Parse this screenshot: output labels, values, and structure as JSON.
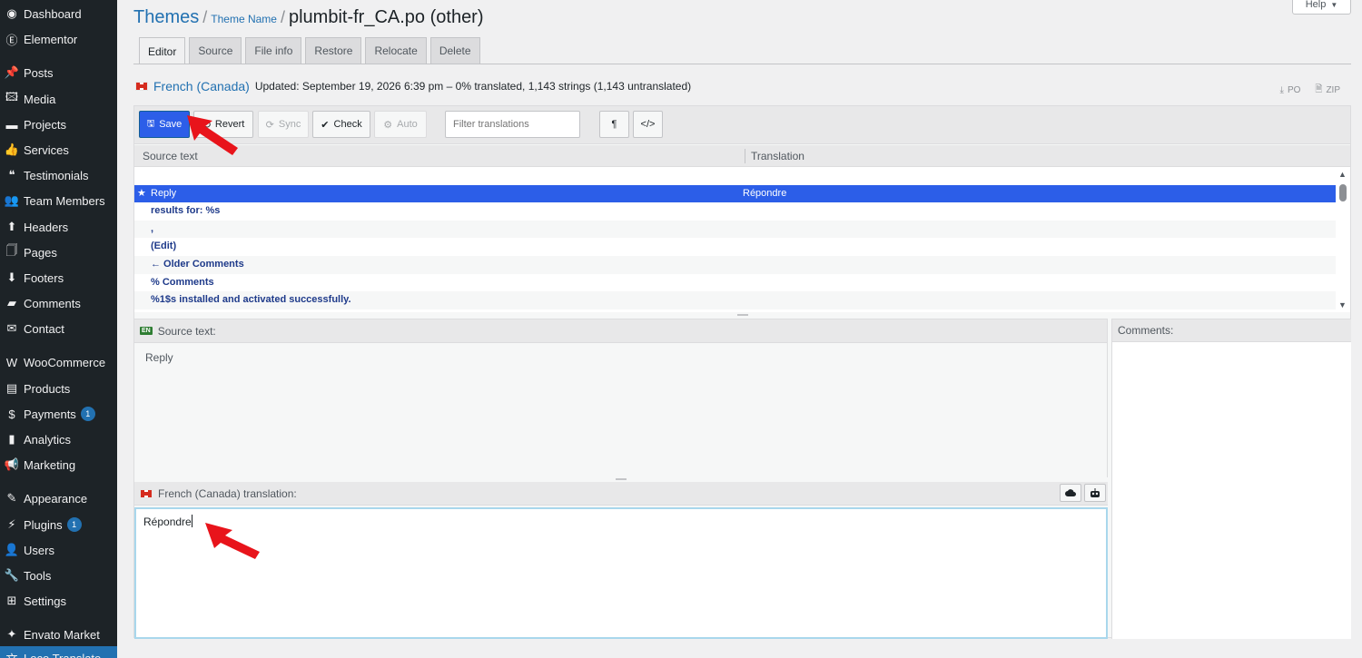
{
  "sidebar": {
    "items": [
      {
        "label": "Dashboard",
        "icon": "dashboard-icon",
        "badge": ""
      },
      {
        "label": "Elementor",
        "icon": "elementor-icon",
        "badge": ""
      },
      {
        "label": "Posts",
        "icon": "pin-icon",
        "badge": ""
      },
      {
        "label": "Media",
        "icon": "media-icon",
        "badge": ""
      },
      {
        "label": "Projects",
        "icon": "folder-icon",
        "badge": ""
      },
      {
        "label": "Services",
        "icon": "thumbs-up-icon",
        "badge": ""
      },
      {
        "label": "Testimonials",
        "icon": "quote-icon",
        "badge": ""
      },
      {
        "label": "Team Members",
        "icon": "team-icon",
        "badge": ""
      },
      {
        "label": "Headers",
        "icon": "headers-icon",
        "badge": ""
      },
      {
        "label": "Pages",
        "icon": "pages-icon",
        "badge": ""
      },
      {
        "label": "Footers",
        "icon": "footers-icon",
        "badge": ""
      },
      {
        "label": "Comments",
        "icon": "comment-icon",
        "badge": ""
      },
      {
        "label": "Contact",
        "icon": "mail-icon",
        "badge": ""
      },
      {
        "label": "WooCommerce",
        "icon": "woocommerce-icon",
        "badge": ""
      },
      {
        "label": "Products",
        "icon": "products-icon",
        "badge": ""
      },
      {
        "label": "Payments",
        "icon": "payments-icon",
        "badge": "1"
      },
      {
        "label": "Analytics",
        "icon": "analytics-icon",
        "badge": ""
      },
      {
        "label": "Marketing",
        "icon": "megaphone-icon",
        "badge": ""
      },
      {
        "label": "Appearance",
        "icon": "brush-icon",
        "badge": ""
      },
      {
        "label": "Plugins",
        "icon": "plugin-icon",
        "badge": "1"
      },
      {
        "label": "Users",
        "icon": "user-icon",
        "badge": ""
      },
      {
        "label": "Tools",
        "icon": "wrench-icon",
        "badge": ""
      },
      {
        "label": "Settings",
        "icon": "settings-icon",
        "badge": ""
      },
      {
        "label": "Envato Market",
        "icon": "envato-icon",
        "badge": ""
      },
      {
        "label": "Loco Translate",
        "icon": "translate-icon",
        "badge": ""
      }
    ]
  },
  "header": {
    "help": "Help",
    "crumb_themes": "Themes",
    "crumb_theme_name": "Theme Name",
    "file_title": "plumbit-fr_CA.po (other)",
    "sep": "/"
  },
  "tabs": [
    "Editor",
    "Source",
    "File info",
    "Restore",
    "Relocate",
    "Delete"
  ],
  "locale": {
    "language": "French (Canada)",
    "updated": "Updated: September 19, 2026 6:39 pm – 0% translated, 1,143 strings (1,143 untranslated)",
    "download_po": "PO",
    "download_zip": "ZIP"
  },
  "toolbar": {
    "save": "Save",
    "revert": "Revert",
    "sync": "Sync",
    "check": "Check",
    "auto": "Auto",
    "filter_placeholder": "Filter translations",
    "invisibles": "¶",
    "code": "</>"
  },
  "table": {
    "col_source": "Source text",
    "col_translation": "Translation",
    "rows": [
      {
        "source": "",
        "translation": ""
      },
      {
        "source": "Reply",
        "translation": "Répondre"
      },
      {
        "source": "results for: %s",
        "translation": ""
      },
      {
        "source": ",",
        "translation": ""
      },
      {
        "source": "(Edit)",
        "translation": ""
      },
      {
        "source": "← Older Comments",
        "translation": ""
      },
      {
        "source": "% Comments",
        "translation": ""
      },
      {
        "source": "%1$s installed and activated successfully.",
        "translation": ""
      }
    ]
  },
  "source_pane": {
    "lang_code": "EN",
    "label": "Source text:",
    "text": "Reply"
  },
  "comments_pane": {
    "label": "Comments:"
  },
  "translation_pane": {
    "label": "French (Canada) translation:",
    "value": "Répondre"
  },
  "colors": {
    "sidebar_bg": "#1d2327",
    "accent": "#2c5ee8",
    "link": "#2271b1",
    "annotation_arrow": "#e8141b",
    "flag_red": "#d52b1e"
  }
}
